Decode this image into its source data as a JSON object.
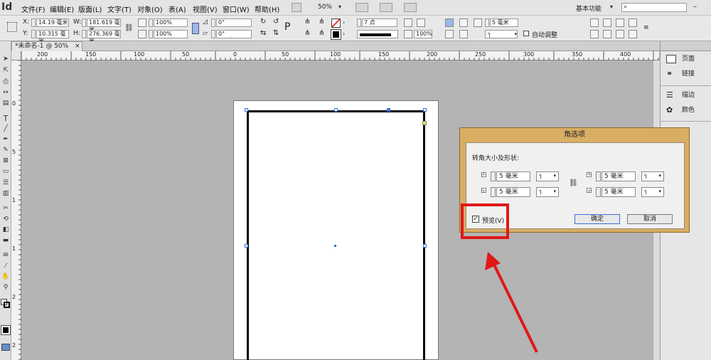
{
  "app": {
    "logo": "Id"
  },
  "menu": [
    "文件(F)",
    "编辑(E)",
    "版面(L)",
    "文字(T)",
    "对象(O)",
    "表(A)",
    "视图(V)",
    "窗口(W)",
    "帮助(H)"
  ],
  "toolbar_top": {
    "zoom": "50%",
    "workspace": "基本功能"
  },
  "control": {
    "x_label": "X:",
    "x_value": "14.19 毫米",
    "y_label": "Y:",
    "y_value": "10.315 毫米",
    "w_label": "W:",
    "w_value": "181.619 毫米",
    "h_label": "H:",
    "h_value": "276.369 毫米",
    "scale_x": "100%",
    "scale_y": "100%",
    "rotate": "0°",
    "shear": "0°",
    "stroke_weight": "7 点",
    "corner_size": "5 毫米",
    "opacity": "100%",
    "auto_fit": "自动调整"
  },
  "document_tab": {
    "title": "*未命名-1 @ 50%",
    "close": "×"
  },
  "ruler": {
    "labels": [
      "200",
      "150",
      "100",
      "50",
      "0",
      "50",
      "100",
      "150",
      "200",
      "250",
      "300",
      "350",
      "400",
      "450"
    ]
  },
  "vruler": {
    "labels": [
      "0",
      "5",
      "1",
      "1",
      "2",
      "2"
    ]
  },
  "right_panel": [
    {
      "label": "页面",
      "icon": "pages-icon"
    },
    {
      "label": "链接",
      "icon": "links-icon"
    },
    {
      "label": "描边",
      "icon": "stroke-icon"
    },
    {
      "label": "颜色",
      "icon": "color-icon"
    }
  ],
  "dialog": {
    "title": "角选项",
    "section_label": "转角大小及形状:",
    "corners": [
      {
        "value": "5 毫米"
      },
      {
        "value": "5 毫米"
      },
      {
        "value": "5 毫米"
      },
      {
        "value": "5 毫米"
      }
    ],
    "preview_label": "预览(V)",
    "preview_checked": true,
    "ok_label": "确定",
    "cancel_label": "取消"
  },
  "colors": {
    "dialog_frame": "#d9ad64",
    "highlight": "#e01818"
  }
}
